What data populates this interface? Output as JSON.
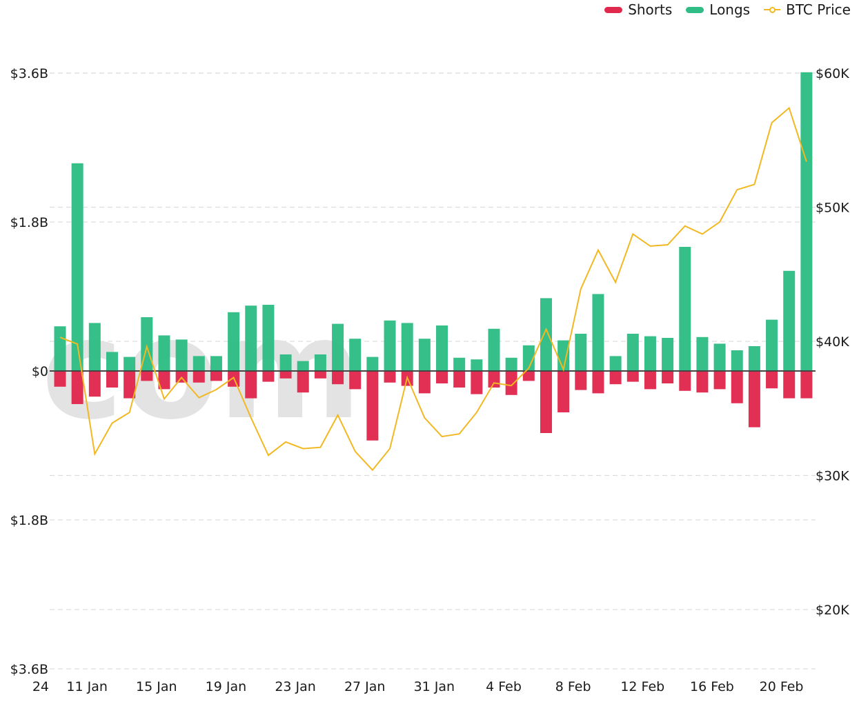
{
  "legend": {
    "shorts_label": "Shorts",
    "longs_label": "Longs",
    "price_label": "BTC Price"
  },
  "colors": {
    "shorts": "#e0294d",
    "longs": "#2fbd85",
    "price": "#f2b822",
    "zero_line": "#444444",
    "grid": "#dddddd",
    "watermark": "#e3e3e3"
  },
  "watermark_text": "com",
  "chart_data": {
    "type": "bar",
    "title": "",
    "xlabel": "",
    "ylabel": "",
    "left_axis": {
      "ylim": [
        -3.6,
        3.6
      ],
      "unit": "USD billions",
      "ticks": [
        3.6,
        1.8,
        0,
        -1.8,
        -3.6
      ],
      "tick_labels": [
        "$3.6B",
        "$1.8B",
        "$0",
        "$1.8B",
        "$3.6B"
      ]
    },
    "right_axis": {
      "ylim": [
        15600,
        60000
      ],
      "unit": "USD",
      "ticks": [
        60000,
        50000,
        40000,
        30000,
        20000
      ],
      "tick_labels": [
        "$60K",
        "$50K",
        "$40K",
        "$30K",
        "$20K"
      ]
    },
    "grid": true,
    "legend_position": "top-right",
    "x_tick_labels": [
      "24",
      "11 Jan",
      "15 Jan",
      "19 Jan",
      "23 Jan",
      "27 Jan",
      "31 Jan",
      "4 Feb",
      "8 Feb",
      "12 Feb",
      "16 Feb",
      "20 Feb"
    ],
    "x_tick_indices": [
      -1,
      1,
      5,
      9,
      13,
      17,
      21,
      25,
      29,
      33,
      37,
      41
    ],
    "categories": [
      "10 Jan",
      "11 Jan",
      "12 Jan",
      "13 Jan",
      "14 Jan",
      "15 Jan",
      "16 Jan",
      "17 Jan",
      "18 Jan",
      "19 Jan",
      "20 Jan",
      "21 Jan",
      "22 Jan",
      "23 Jan",
      "24 Jan",
      "25 Jan",
      "26 Jan",
      "27 Jan",
      "28 Jan",
      "29 Jan",
      "30 Jan",
      "31 Jan",
      "1 Feb",
      "2 Feb",
      "3 Feb",
      "4 Feb",
      "5 Feb",
      "6 Feb",
      "7 Feb",
      "8 Feb",
      "9 Feb",
      "10 Feb",
      "11 Feb",
      "12 Feb",
      "13 Feb",
      "14 Feb",
      "15 Feb",
      "16 Feb",
      "17 Feb",
      "18 Feb",
      "19 Feb",
      "20 Feb",
      "21 Feb",
      "22 Feb"
    ],
    "series": [
      {
        "name": "Longs",
        "axis": "left",
        "values": [
          0.54,
          2.51,
          0.58,
          0.23,
          0.17,
          0.65,
          0.43,
          0.38,
          0.18,
          0.18,
          0.71,
          0.79,
          0.8,
          0.2,
          0.12,
          0.2,
          0.57,
          0.39,
          0.17,
          0.61,
          0.58,
          0.39,
          0.55,
          0.16,
          0.14,
          0.51,
          0.16,
          0.31,
          0.88,
          0.37,
          0.45,
          0.93,
          0.18,
          0.45,
          0.42,
          0.4,
          1.5,
          0.41,
          0.33,
          0.25,
          0.3,
          0.62,
          1.21,
          3.61
        ]
      },
      {
        "name": "Shorts",
        "axis": "left",
        "values": [
          -0.19,
          -0.4,
          -0.31,
          -0.2,
          -0.33,
          -0.12,
          -0.22,
          -0.14,
          -0.14,
          -0.12,
          -0.19,
          -0.33,
          -0.13,
          -0.09,
          -0.26,
          -0.09,
          -0.16,
          -0.22,
          -0.84,
          -0.14,
          -0.18,
          -0.27,
          -0.15,
          -0.2,
          -0.28,
          -0.2,
          -0.29,
          -0.12,
          -0.75,
          -0.5,
          -0.23,
          -0.27,
          -0.16,
          -0.13,
          -0.22,
          -0.15,
          -0.24,
          -0.26,
          -0.22,
          -0.39,
          -0.68,
          -0.21,
          -0.33,
          -0.33
        ]
      },
      {
        "name": "BTC Price",
        "axis": "right",
        "type": "line",
        "values": [
          40300,
          39800,
          31600,
          33900,
          34700,
          39600,
          35700,
          37300,
          35800,
          36400,
          37300,
          34300,
          31500,
          32500,
          32000,
          32100,
          34500,
          31800,
          30400,
          32000,
          37300,
          34300,
          32900,
          33100,
          34700,
          36900,
          36700,
          38000,
          40900,
          37900,
          43900,
          46800,
          44400,
          48000,
          47100,
          47200,
          48600,
          48000,
          48900,
          51300,
          51700,
          56300,
          57400,
          53400
        ]
      }
    ]
  }
}
